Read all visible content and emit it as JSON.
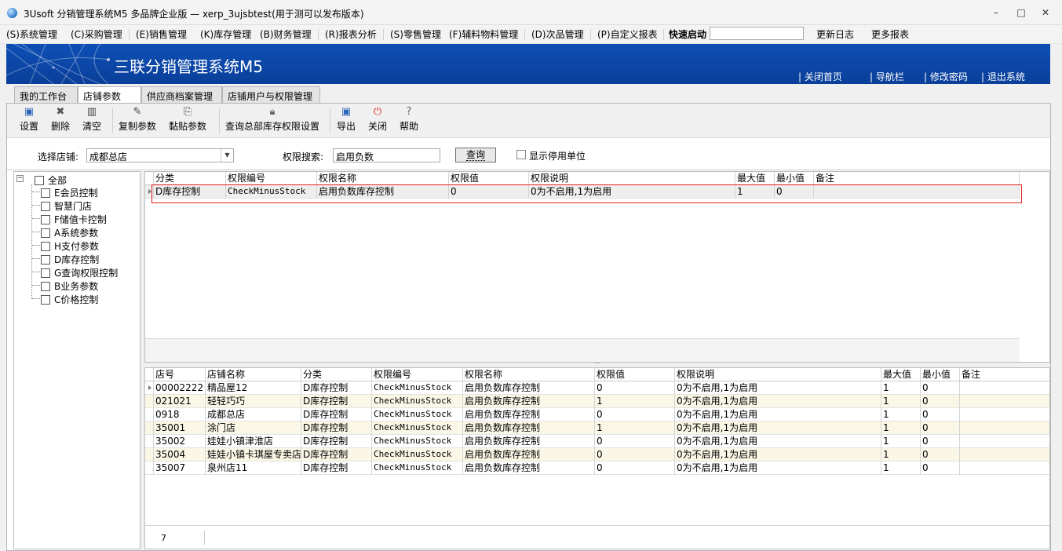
{
  "window": {
    "title": "3Usoft 分销管理系统M5 多品牌企业版 — xerp_3ujsbtest(用于测可以发布版本)",
    "controls": [
      "–",
      "□",
      "✕"
    ]
  },
  "menubar": {
    "items": [
      "(S)系统管理",
      "(C)采购管理",
      "(E)销售管理",
      "(K)库存管理",
      "(B)财务管理",
      "(R)报表分析",
      "(S)零售管理",
      "(F)辅料物料管理",
      "(D)次品管理",
      "(P)自定义报表"
    ],
    "quick_launch_label": "快速启动",
    "quick_launch_value": "",
    "update_log": "更新日志",
    "more_reports": "更多报表"
  },
  "banner": {
    "title": "三联分销管理系统M5",
    "links": [
      "关闭首页",
      "导航栏",
      "修改密码",
      "退出系统"
    ]
  },
  "tabs": [
    "我的工作台",
    "店铺参数",
    "供应商档案管理",
    "店铺用户与权限管理"
  ],
  "toolbar": {
    "set": "设置",
    "delete": "删除",
    "clear": "清空",
    "copy_params": "复制参数",
    "paste_params": "黏贴参数",
    "query_hq_stock": "查询总部库存权限设置",
    "export": "导出",
    "close": "关闭",
    "help": "帮助"
  },
  "filter": {
    "store_label": "选择店铺:",
    "store_value": "成都总店",
    "search_label": "权限搜索:",
    "search_value": "启用负数",
    "query_button": "查询",
    "show_disabled_label": "显示停用单位"
  },
  "tree": {
    "root": "全部",
    "children": [
      "E会员控制",
      "智慧门店",
      "F储值卡控制",
      "A系统参数",
      "H支付参数",
      "D库存控制",
      "G查询权限控制",
      "B业务参数",
      "C价格控制"
    ]
  },
  "top_grid": {
    "columns": [
      "分类",
      "权限编号",
      "权限名称",
      "权限值",
      "权限说明",
      "最大值",
      "最小值",
      "备注"
    ],
    "rows": [
      [
        "D库存控制",
        "CheckMinusStock",
        "启用负数库存控制",
        "0",
        "0为不启用,1为启用",
        "1",
        "0",
        ""
      ]
    ]
  },
  "bottom_grid": {
    "columns": [
      "店号",
      "店铺名称",
      "分类",
      "权限编号",
      "权限名称",
      "权限值",
      "权限说明",
      "最大值",
      "最小值",
      "备注"
    ],
    "rows": [
      [
        "00002222",
        "精品屋12",
        "D库存控制",
        "CheckMinusStock",
        "启用负数库存控制",
        "0",
        "0为不启用,1为启用",
        "1",
        "0",
        ""
      ],
      [
        "021021",
        "轻轻巧巧",
        "D库存控制",
        "CheckMinusStock",
        "启用负数库存控制",
        "1",
        "0为不启用,1为启用",
        "1",
        "0",
        ""
      ],
      [
        "0918",
        "成都总店",
        "D库存控制",
        "CheckMinusStock",
        "启用负数库存控制",
        "0",
        "0为不启用,1为启用",
        "1",
        "0",
        ""
      ],
      [
        "35001",
        "涂门店",
        "D库存控制",
        "CheckMinusStock",
        "启用负数库存控制",
        "1",
        "0为不启用,1为启用",
        "1",
        "0",
        ""
      ],
      [
        "35002",
        "娃娃小镇津淮店",
        "D库存控制",
        "CheckMinusStock",
        "启用负数库存控制",
        "0",
        "0为不启用,1为启用",
        "1",
        "0",
        ""
      ],
      [
        "35004",
        "娃娃小镇卡琪屋专卖店",
        "D库存控制",
        "CheckMinusStock",
        "启用负数库存控制",
        "0",
        "0为不启用,1为启用",
        "1",
        "0",
        ""
      ],
      [
        "35007",
        "泉州店11",
        "D库存控制",
        "CheckMinusStock",
        "启用负数库存控制",
        "0",
        "0为不启用,1为启用",
        "1",
        "0",
        ""
      ]
    ],
    "footer_count": "7"
  },
  "colors": {
    "banner_blue": "#0e4fb6",
    "highlight_red": "#e0201f",
    "alt_row": "#fbf7e6"
  }
}
